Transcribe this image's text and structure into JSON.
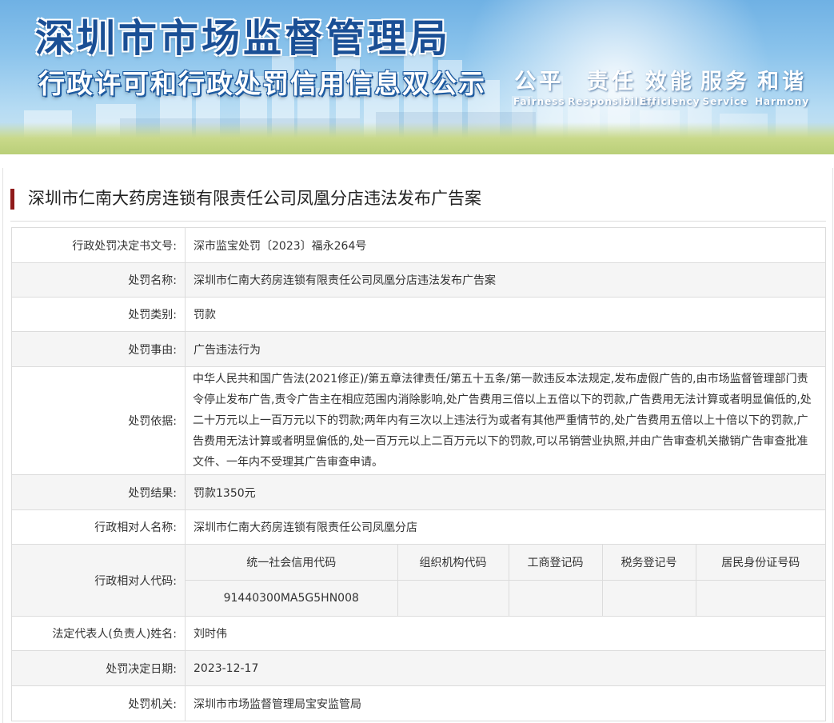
{
  "banner": {
    "title": "深圳市市场监督管理局",
    "subtitle": "行政许可和行政处罚信用信息双公示",
    "motto": [
      {
        "zh": "公平",
        "en": "Fairness"
      },
      {
        "zh": "责任",
        "en": "Responsibility"
      },
      {
        "zh": "效能",
        "en": "Efficiency"
      },
      {
        "zh": "服务",
        "en": "Service"
      },
      {
        "zh": "和谐",
        "en": "Harmony"
      }
    ]
  },
  "case": {
    "title": "深圳市仁南大药房连锁有限责任公司凤凰分店违法发布广告案"
  },
  "rows": {
    "doc_no": {
      "label": "行政处罚决定书文号:",
      "value": "深市监宝处罚〔2023〕福永264号"
    },
    "name": {
      "label": "处罚名称:",
      "value": "深圳市仁南大药房连锁有限责任公司凤凰分店违法发布广告案"
    },
    "category": {
      "label": "处罚类别:",
      "value": "罚款"
    },
    "reason": {
      "label": "处罚事由:",
      "value": "广告违法行为"
    },
    "basis": {
      "label": "处罚依据:",
      "value": "中华人民共和国广告法(2021修正)/第五章法律责任/第五十五条/第一款违反本法规定,发布虚假广告的,由市场监督管理部门责令停止发布广告,责令广告主在相应范围内消除影响,处广告费用三倍以上五倍以下的罚款,广告费用无法计算或者明显偏低的,处二十万元以上一百万元以下的罚款;两年内有三次以上违法行为或者有其他严重情节的,处广告费用五倍以上十倍以下的罚款,广告费用无法计算或者明显偏低的,处一百万元以上二百万元以下的罚款,可以吊销营业执照,并由广告审查机关撤销广告审查批准文件、一年内不受理其广告审查申请。"
    },
    "result": {
      "label": "处罚结果:",
      "value": "罚款1350元"
    },
    "party_name": {
      "label": "行政相对人名称:",
      "value": "深圳市仁南大药房连锁有限责任公司凤凰分店"
    },
    "party_code": {
      "label": "行政相对人代码:",
      "headers": [
        "统一社会信用代码",
        "组织机构代码",
        "工商登记码",
        "税务登记号",
        "居民身份证号码"
      ],
      "values": [
        "91440300MA5G5HN008",
        "",
        "",
        "",
        ""
      ]
    },
    "legal_rep": {
      "label": "法定代表人(负责人)姓名:",
      "value": "刘时伟"
    },
    "date": {
      "label": "处罚决定日期:",
      "value": "2023-12-17"
    },
    "authority": {
      "label": "处罚机关:",
      "value": "深圳市市场监督管理局宝安监管局"
    }
  },
  "colors": {
    "heading_bar": "#8f1a1a",
    "banner_title": "#1a4f95",
    "alt_row_bg": "#f5f5f5",
    "border": "#dcdcdc"
  }
}
